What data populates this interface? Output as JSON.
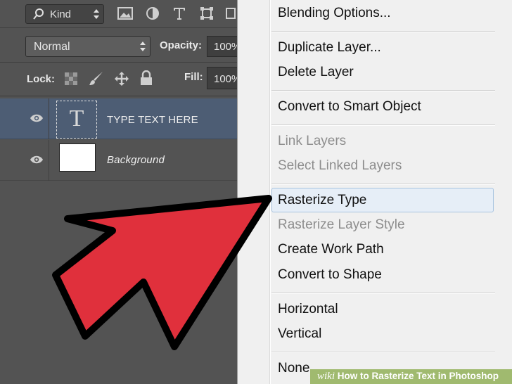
{
  "layers_panel": {
    "filter": {
      "label": "Kind",
      "icons": [
        "image-filter-icon",
        "adjustment-filter-icon",
        "type-filter-icon",
        "shape-filter-icon",
        "smart-object-filter-icon"
      ]
    },
    "blend_mode": "Normal",
    "opacity_label": "Opacity:",
    "opacity_value": "100%",
    "lock_label": "Lock:",
    "fill_label": "Fill:",
    "fill_value": "100%",
    "layers": [
      {
        "name": "TYPE  TEXT HERE",
        "thumb": "T",
        "selected": true
      },
      {
        "name": "Background",
        "selected": false
      }
    ]
  },
  "context_menu": {
    "items": [
      {
        "label": "Blending Options...",
        "enabled": true
      },
      {
        "label": "Duplicate Layer...",
        "enabled": true
      },
      {
        "label": "Delete Layer",
        "enabled": true
      },
      {
        "label": "Convert to Smart Object",
        "enabled": true
      },
      {
        "label": "Link Layers",
        "enabled": false
      },
      {
        "label": "Select Linked Layers",
        "enabled": false
      },
      {
        "label": "Rasterize Type",
        "enabled": true,
        "highlighted": true
      },
      {
        "label": "Rasterize Layer Style",
        "enabled": false
      },
      {
        "label": "Create Work Path",
        "enabled": true
      },
      {
        "label": "Convert to Shape",
        "enabled": true
      },
      {
        "label": "Horizontal",
        "enabled": true
      },
      {
        "label": "Vertical",
        "enabled": true
      },
      {
        "label": "None",
        "enabled": true
      }
    ]
  },
  "annotation": {
    "arrow_color": "#e0303c"
  },
  "watermark": {
    "brand": "wiki",
    "title": "How to Rasterize Text in Photoshop"
  },
  "colors": {
    "selected_layer": "#4d5d74",
    "panel": "#535353",
    "menu_bg": "#f0f0f0",
    "menu_highlight": "#e6eef7"
  }
}
